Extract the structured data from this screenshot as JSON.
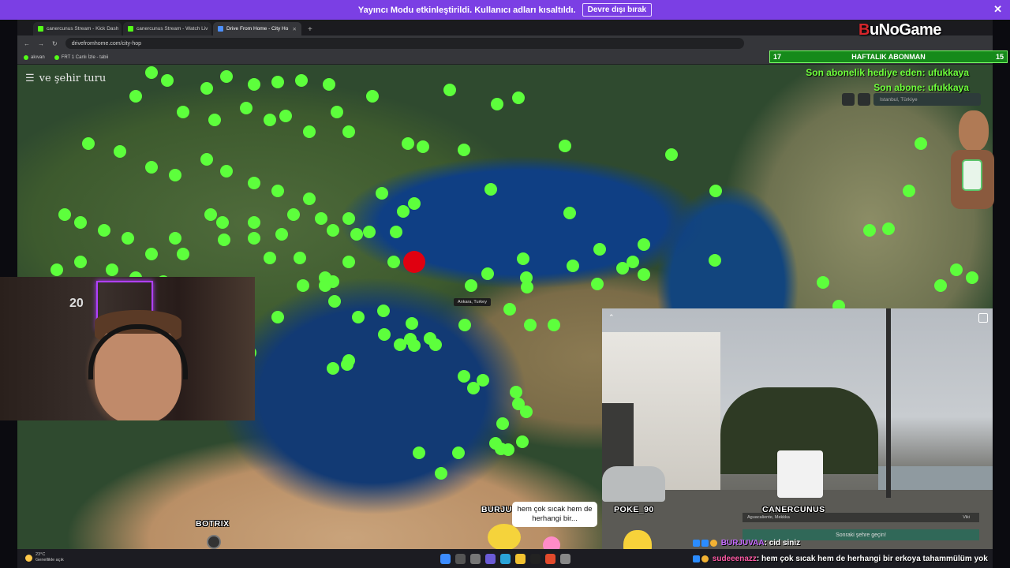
{
  "banner": {
    "message": "Yayıncı Modu etkinleştirildi. Kullanıcı adları kısaltıldı.",
    "button_label": "Devre dışı bırak",
    "close_glyph": "✕"
  },
  "browser": {
    "tabs": [
      {
        "label": "canercunus Stream - Kick Dash",
        "active": false
      },
      {
        "label": "canercunus Stream - Watch Liv",
        "active": false
      },
      {
        "label": "Drive From Home - City Ho",
        "active": true
      }
    ],
    "new_tab_glyph": "+",
    "url": "drivefromhome.com/city-hop",
    "bookmarks": [
      "akıvan",
      "FRT 1 Canlı İzle - tabii"
    ]
  },
  "map": {
    "title": "ve şehir turu",
    "place_label": "Ankara, Turkey",
    "search_value": "Istanbul, Türkiye",
    "accent_dot_color": "#5dff3c",
    "current_dot_color": "#e00010"
  },
  "overlay": {
    "goal_left": "17",
    "goal_label": "HAFTALIK ABONMAN",
    "goal_right": "15",
    "last_gift": "Son abonelik hediye eden: ufukkaya",
    "last_sub": "Son abone: ufukkaya",
    "logo_prefix": "B",
    "logo_rest": "uNoGame"
  },
  "webcam": {
    "jersey_number": "20"
  },
  "video": {
    "panel_left": "Aguacaliente, Mekkka",
    "panel_right": "Viki",
    "next_button": "Sonraki şehre geçin!"
  },
  "name_tags": {
    "botrix": "BOTRIX",
    "burjuvaa": "BURJU",
    "poke": "POKE_90",
    "canercunus": "CANERCUNUS"
  },
  "speech_bubble": "hem çok sıcak hem de herhangi bir...",
  "taskbar": {
    "temperature": "23°C",
    "weather": "Genellikle açık"
  },
  "chat": [
    {
      "user": "BURJUVAA",
      "message": ": cid    siniz"
    },
    {
      "user": "sudeeenazz",
      "message": ": hem çok sıcak hem de herhangi bir erkoya tahammülüm yok"
    }
  ]
}
